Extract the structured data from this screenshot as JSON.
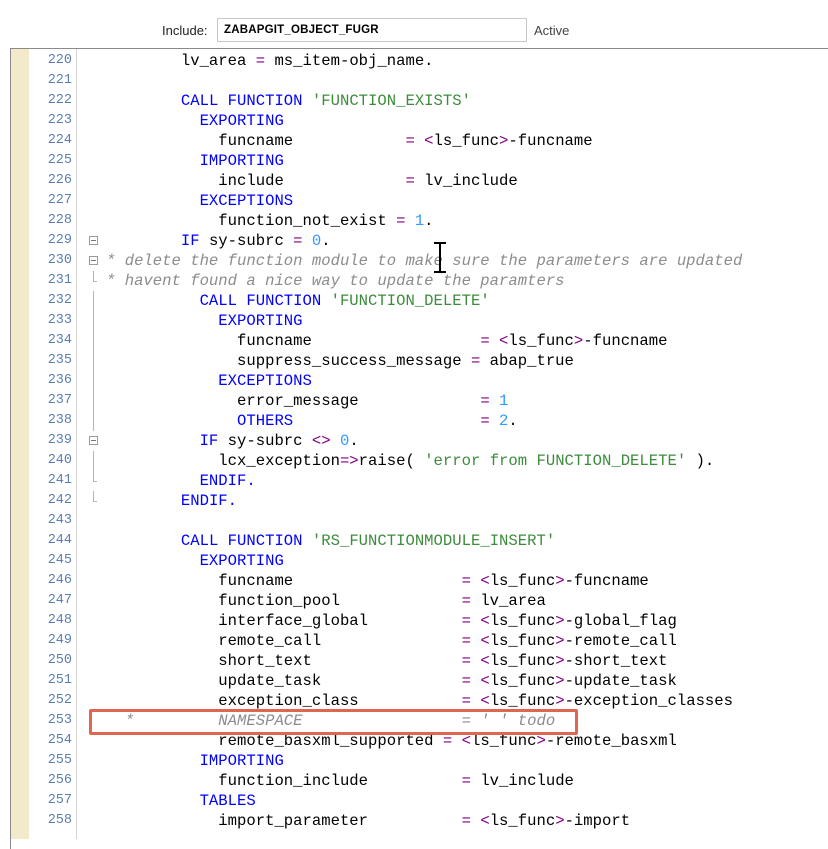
{
  "header": {
    "include_label": "Include:",
    "include_value": "ZABAPGIT_OBJECT_FUGR",
    "status": "Active"
  },
  "lines": [
    {
      "n": "220",
      "fold": "none",
      "tokens": [
        [
          "        lv_area ",
          ""
        ],
        [
          "=",
          "op"
        ],
        [
          " ms_item-obj_name.",
          ""
        ]
      ]
    },
    {
      "n": "221",
      "fold": "none",
      "tokens": [
        [
          "",
          ""
        ]
      ]
    },
    {
      "n": "222",
      "fold": "none",
      "tokens": [
        [
          "        ",
          ""
        ],
        [
          "CALL FUNCTION",
          "kw"
        ],
        [
          " ",
          ""
        ],
        [
          "'FUNCTION_EXISTS'",
          "str"
        ]
      ]
    },
    {
      "n": "223",
      "fold": "none",
      "tokens": [
        [
          "          ",
          ""
        ],
        [
          "EXPORTING",
          "kw"
        ]
      ]
    },
    {
      "n": "224",
      "fold": "none",
      "tokens": [
        [
          "            funcname            ",
          ""
        ],
        [
          "=",
          "op"
        ],
        [
          " ",
          ""
        ],
        [
          "<",
          "op"
        ],
        [
          "ls_func",
          ""
        ],
        [
          ">",
          "op"
        ],
        [
          "-funcname",
          ""
        ]
      ]
    },
    {
      "n": "225",
      "fold": "none",
      "tokens": [
        [
          "          ",
          ""
        ],
        [
          "IMPORTING",
          "kw"
        ]
      ]
    },
    {
      "n": "226",
      "fold": "none",
      "tokens": [
        [
          "            include             ",
          ""
        ],
        [
          "=",
          "op"
        ],
        [
          " lv_include",
          ""
        ]
      ]
    },
    {
      "n": "227",
      "fold": "none",
      "tokens": [
        [
          "          ",
          ""
        ],
        [
          "EXCEPTIONS",
          "kw"
        ]
      ]
    },
    {
      "n": "228",
      "fold": "none",
      "tokens": [
        [
          "            function_not_exist ",
          ""
        ],
        [
          "=",
          "op"
        ],
        [
          " ",
          ""
        ],
        [
          "1",
          "num"
        ],
        [
          ".",
          ""
        ]
      ]
    },
    {
      "n": "229",
      "fold": "open",
      "tokens": [
        [
          "        ",
          ""
        ],
        [
          "IF",
          "kw"
        ],
        [
          " sy-subrc ",
          ""
        ],
        [
          "=",
          "op"
        ],
        [
          " ",
          ""
        ],
        [
          "0",
          "num"
        ],
        [
          ".",
          ""
        ]
      ]
    },
    {
      "n": "230",
      "fold": "open",
      "tokens": [
        [
          "* delete the function module to make sure the parameters are updated",
          "cmt"
        ]
      ]
    },
    {
      "n": "231",
      "fold": "end",
      "tokens": [
        [
          "* havent found a nice way to update the paramters",
          "cmt"
        ]
      ]
    },
    {
      "n": "232",
      "fold": "line",
      "tokens": [
        [
          "          ",
          ""
        ],
        [
          "CALL FUNCTION",
          "kw"
        ],
        [
          " ",
          ""
        ],
        [
          "'FUNCTION_DELETE'",
          "str"
        ]
      ]
    },
    {
      "n": "233",
      "fold": "line",
      "tokens": [
        [
          "            ",
          ""
        ],
        [
          "EXPORTING",
          "kw"
        ]
      ]
    },
    {
      "n": "234",
      "fold": "line",
      "tokens": [
        [
          "              funcname                  ",
          ""
        ],
        [
          "=",
          "op"
        ],
        [
          " ",
          ""
        ],
        [
          "<",
          "op"
        ],
        [
          "ls_func",
          ""
        ],
        [
          ">",
          "op"
        ],
        [
          "-funcname",
          ""
        ]
      ]
    },
    {
      "n": "235",
      "fold": "line",
      "tokens": [
        [
          "              suppress_success_message ",
          ""
        ],
        [
          "=",
          "op"
        ],
        [
          " abap_true",
          ""
        ]
      ]
    },
    {
      "n": "236",
      "fold": "line",
      "tokens": [
        [
          "            ",
          ""
        ],
        [
          "EXCEPTIONS",
          "kw"
        ]
      ]
    },
    {
      "n": "237",
      "fold": "line",
      "tokens": [
        [
          "              error_message             ",
          ""
        ],
        [
          "=",
          "op"
        ],
        [
          " ",
          ""
        ],
        [
          "1",
          "num"
        ]
      ]
    },
    {
      "n": "238",
      "fold": "line",
      "tokens": [
        [
          "              ",
          ""
        ],
        [
          "OTHERS",
          "kw"
        ],
        [
          "                    ",
          ""
        ],
        [
          "=",
          "op"
        ],
        [
          " ",
          ""
        ],
        [
          "2",
          "num"
        ],
        [
          ".",
          ""
        ]
      ]
    },
    {
      "n": "239",
      "fold": "open",
      "tokens": [
        [
          "          ",
          ""
        ],
        [
          "IF",
          "kw"
        ],
        [
          " sy-subrc ",
          ""
        ],
        [
          "<>",
          "op"
        ],
        [
          " ",
          ""
        ],
        [
          "0",
          "num"
        ],
        [
          ".",
          ""
        ]
      ]
    },
    {
      "n": "240",
      "fold": "line",
      "tokens": [
        [
          "            lcx_exception",
          ""
        ],
        [
          "=>",
          "op"
        ],
        [
          "raise( ",
          ""
        ],
        [
          "'error from FUNCTION_DELETE'",
          "str"
        ],
        [
          " ).",
          ""
        ]
      ]
    },
    {
      "n": "241",
      "fold": "end",
      "tokens": [
        [
          "          ",
          ""
        ],
        [
          "ENDIF.",
          "kw"
        ]
      ]
    },
    {
      "n": "242",
      "fold": "end",
      "tokens": [
        [
          "        ",
          ""
        ],
        [
          "ENDIF.",
          "kw"
        ]
      ]
    },
    {
      "n": "243",
      "fold": "none",
      "tokens": [
        [
          "",
          ""
        ]
      ]
    },
    {
      "n": "244",
      "fold": "none",
      "tokens": [
        [
          "        ",
          ""
        ],
        [
          "CALL FUNCTION",
          "kw"
        ],
        [
          " ",
          ""
        ],
        [
          "'RS_FUNCTIONMODULE_INSERT'",
          "str"
        ]
      ]
    },
    {
      "n": "245",
      "fold": "none",
      "tokens": [
        [
          "          ",
          ""
        ],
        [
          "EXPORTING",
          "kw"
        ]
      ]
    },
    {
      "n": "246",
      "fold": "none",
      "tokens": [
        [
          "            funcname                  ",
          ""
        ],
        [
          "=",
          "op"
        ],
        [
          " ",
          ""
        ],
        [
          "<",
          "op"
        ],
        [
          "ls_func",
          ""
        ],
        [
          ">",
          "op"
        ],
        [
          "-funcname",
          ""
        ]
      ]
    },
    {
      "n": "247",
      "fold": "none",
      "tokens": [
        [
          "            function_pool             ",
          ""
        ],
        [
          "=",
          "op"
        ],
        [
          " lv_area",
          ""
        ]
      ]
    },
    {
      "n": "248",
      "fold": "none",
      "tokens": [
        [
          "            interface_global          ",
          ""
        ],
        [
          "=",
          "op"
        ],
        [
          " ",
          ""
        ],
        [
          "<",
          "op"
        ],
        [
          "ls_func",
          ""
        ],
        [
          ">",
          "op"
        ],
        [
          "-global_flag",
          ""
        ]
      ]
    },
    {
      "n": "249",
      "fold": "none",
      "tokens": [
        [
          "            remote_call               ",
          ""
        ],
        [
          "=",
          "op"
        ],
        [
          " ",
          ""
        ],
        [
          "<",
          "op"
        ],
        [
          "ls_func",
          ""
        ],
        [
          ">",
          "op"
        ],
        [
          "-remote_call",
          ""
        ]
      ]
    },
    {
      "n": "250",
      "fold": "none",
      "tokens": [
        [
          "            short_text                ",
          ""
        ],
        [
          "=",
          "op"
        ],
        [
          " ",
          ""
        ],
        [
          "<",
          "op"
        ],
        [
          "ls_func",
          ""
        ],
        [
          ">",
          "op"
        ],
        [
          "-short_text",
          ""
        ]
      ]
    },
    {
      "n": "251",
      "fold": "none",
      "tokens": [
        [
          "            update_task               ",
          ""
        ],
        [
          "=",
          "op"
        ],
        [
          " ",
          ""
        ],
        [
          "<",
          "op"
        ],
        [
          "ls_func",
          ""
        ],
        [
          ">",
          "op"
        ],
        [
          "-update_task",
          ""
        ]
      ]
    },
    {
      "n": "252",
      "fold": "none",
      "tokens": [
        [
          "            exception_class           ",
          ""
        ],
        [
          "=",
          "op"
        ],
        [
          " ",
          ""
        ],
        [
          "<",
          "op"
        ],
        [
          "ls_func",
          ""
        ],
        [
          ">",
          "op"
        ],
        [
          "-exception_classes",
          ""
        ]
      ]
    },
    {
      "n": "253",
      "fold": "none",
      "tokens": [
        [
          "  *         NAMESPACE                 = ' ' todo",
          "cmt"
        ]
      ]
    },
    {
      "n": "254",
      "fold": "none",
      "tokens": [
        [
          "            remote_basxml_supported ",
          ""
        ],
        [
          "=",
          "op"
        ],
        [
          " ",
          ""
        ],
        [
          "<",
          "op"
        ],
        [
          "ls_func",
          ""
        ],
        [
          ">",
          "op"
        ],
        [
          "-remote_basxml",
          ""
        ]
      ]
    },
    {
      "n": "255",
      "fold": "none",
      "tokens": [
        [
          "          ",
          ""
        ],
        [
          "IMPORTING",
          "kw"
        ]
      ]
    },
    {
      "n": "256",
      "fold": "none",
      "tokens": [
        [
          "            function_include          ",
          ""
        ],
        [
          "=",
          "op"
        ],
        [
          " lv_include",
          ""
        ]
      ]
    },
    {
      "n": "257",
      "fold": "none",
      "tokens": [
        [
          "          ",
          ""
        ],
        [
          "TABLES",
          "kw"
        ]
      ]
    },
    {
      "n": "258",
      "fold": "none",
      "tokens": [
        [
          "            import_parameter          ",
          ""
        ],
        [
          "=",
          "op"
        ],
        [
          " ",
          ""
        ],
        [
          "<",
          "op"
        ],
        [
          "ls_func",
          ""
        ],
        [
          ">",
          "op"
        ],
        [
          "-import",
          ""
        ]
      ]
    }
  ],
  "colors": {
    "keyword": "#0000ff",
    "string": "#3c8c3c",
    "number": "#3399ff",
    "operator": "#800080",
    "comment": "#8c8c8c",
    "line_number": "#5b7fb4",
    "highlight_border": "#e06652"
  }
}
